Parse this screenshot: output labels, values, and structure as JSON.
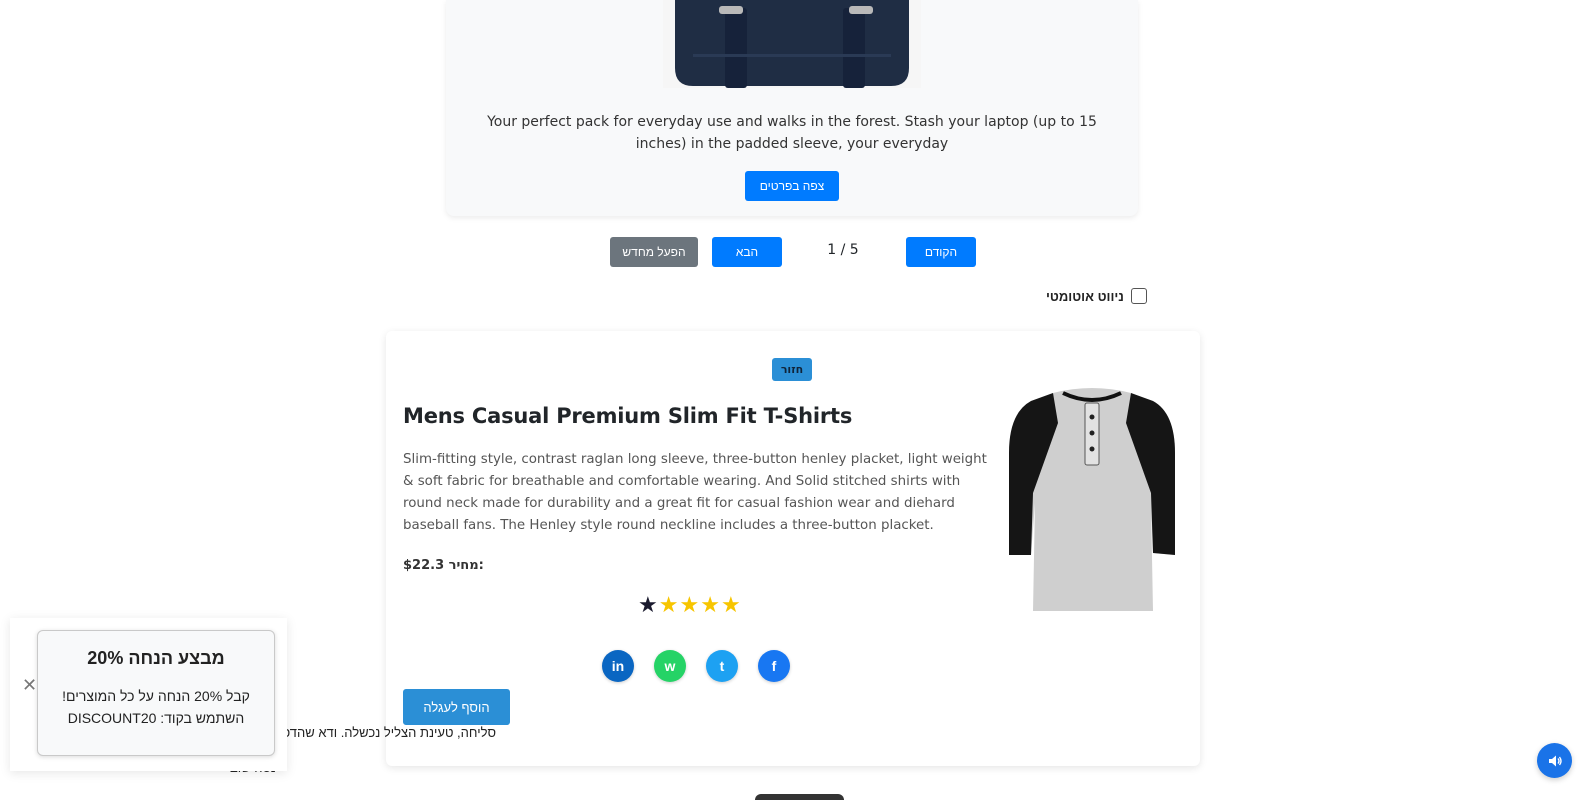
{
  "carousel": {
    "description": "Your perfect pack for everyday use and walks in the forest. Stash your laptop (up to 15 inches) in the padded sleeve, your everyday",
    "details_button": "צפה בפרטים",
    "restart_button": "הפעל מחדש",
    "next_button": "הבא",
    "prev_button": "הקודם",
    "page_counter": "1 / 5",
    "autonav_label": "ניווט אוטומטי",
    "autonav_checked": false
  },
  "product": {
    "back_badge": "חזור",
    "title": "Mens Casual Premium Slim Fit T-Shirts",
    "description": "Slim-fitting style, contrast raglan long sleeve, three-button henley placket, light weight & soft fabric for breathable and comfortable wearing. And Solid stitched shirts with round neck made for durability and a great fit for casual fashion wear and diehard baseball fans. The Henley style round neckline includes a three-button placket.",
    "price_label": "מחיר:",
    "price_value": "$22.3",
    "rating": 4,
    "rating_max": 5,
    "share": [
      {
        "network": "facebook",
        "icon": "facebook-icon",
        "glyph": "f",
        "color": "#1877f2"
      },
      {
        "network": "twitter",
        "icon": "twitter-icon",
        "glyph": "t",
        "color": "#1da1f2"
      },
      {
        "network": "whatsapp",
        "icon": "whatsapp-icon",
        "glyph": "w",
        "color": "#25d366"
      },
      {
        "network": "linkedin",
        "icon": "linkedin-icon",
        "glyph": "in",
        "color": "#0a66c2"
      }
    ],
    "add_to_cart": "הוסף לעגלה"
  },
  "error": {
    "line1": "סליחה, טעינת הצליל נכשלה. ודא שהדפדפן",
    "line2": "נסה שוב"
  },
  "popup": {
    "title": "מבצע הנחה 20%",
    "line1": "קבל 20% הנחה על כל המוצרים!",
    "line2": "השתמש בקוד: DISCOUNT20",
    "close_glyph": "✕"
  },
  "colors": {
    "primary": "#007bff",
    "secondary": "#6c757d",
    "star": "#f7c500",
    "sound_button": "#1a73e8"
  }
}
